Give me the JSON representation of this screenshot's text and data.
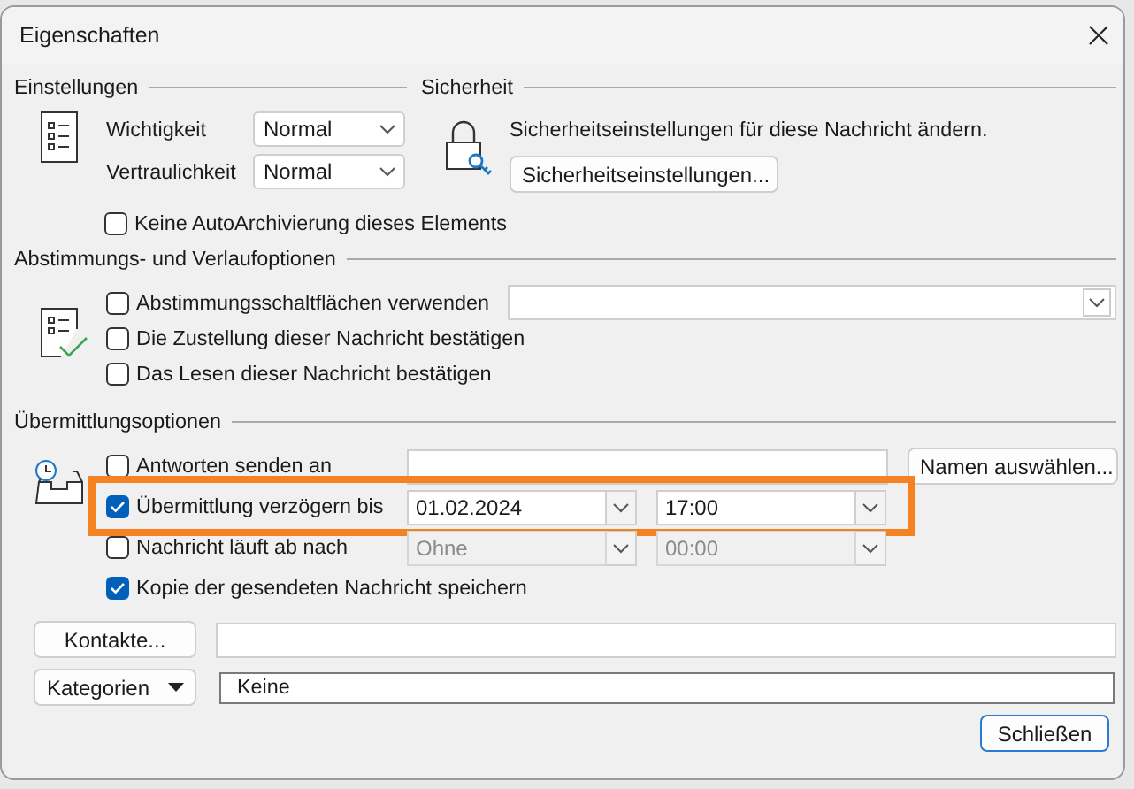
{
  "window": {
    "title": "Eigenschaften"
  },
  "settings": {
    "heading": "Einstellungen",
    "fields": [
      {
        "label": "Wichtigkeit",
        "value": "Normal"
      },
      {
        "label": "Vertraulichkeit",
        "value": "Normal"
      }
    ],
    "no_autoarchive": {
      "label": "Keine AutoArchivierung dieses Elements",
      "checked": false
    }
  },
  "security": {
    "heading": "Sicherheit",
    "text": "Sicherheitseinstellungen für diese Nachricht ändern.",
    "button": "Sicherheitseinstellungen..."
  },
  "tracking": {
    "heading": "Abstimmungs- und Verlaufoptionen",
    "options": [
      {
        "label": "Abstimmungsschaltflächen verwenden",
        "checked": false
      },
      {
        "label": "Die Zustellung dieser Nachricht bestätigen",
        "checked": false
      },
      {
        "label": "Das Lesen dieser Nachricht bestätigen",
        "checked": false
      }
    ]
  },
  "delivery": {
    "heading": "Übermittlungsoptionen",
    "rows": [
      {
        "kind": "reply",
        "label": "Antworten senden an",
        "checked": false,
        "button": "Namen auswählen...",
        "highlighted": false
      },
      {
        "kind": "datetime",
        "label": "Übermittlung verzögern bis",
        "checked": true,
        "date": "01.02.2024",
        "time": "17:00",
        "disabled": false,
        "highlighted": true
      },
      {
        "kind": "datetime",
        "label": "Nachricht läuft ab nach",
        "checked": false,
        "date": "Ohne",
        "time": "00:00",
        "disabled": true,
        "highlighted": false
      },
      {
        "kind": "check",
        "label": "Kopie der gesendeten Nachricht speichern",
        "checked": true,
        "highlighted": false
      }
    ]
  },
  "contacts": {
    "button": "Kontakte..."
  },
  "categories": {
    "button": "Kategorien",
    "value": "Keine"
  },
  "close_button": "Schließen"
}
